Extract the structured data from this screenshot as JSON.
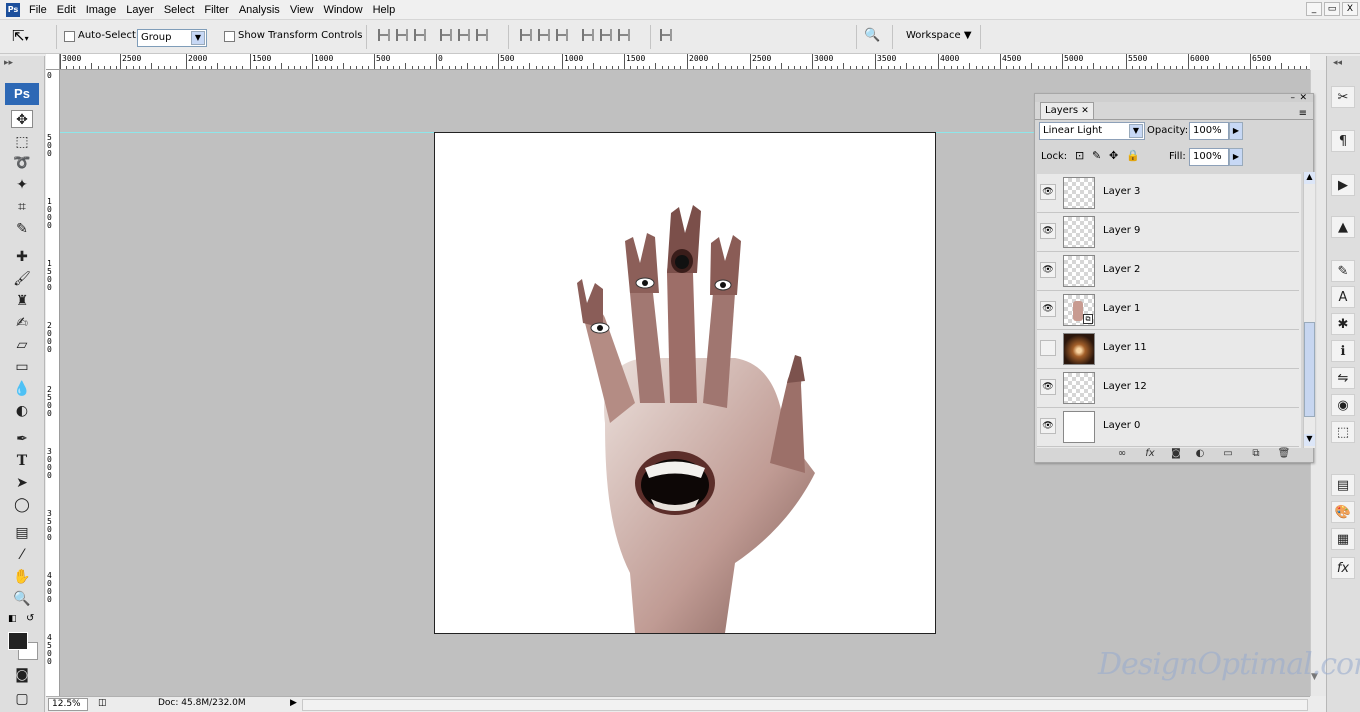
{
  "app": {
    "icon_label": "Ps"
  },
  "menu": [
    "File",
    "Edit",
    "Image",
    "Layer",
    "Select",
    "Filter",
    "Analysis",
    "View",
    "Window",
    "Help"
  ],
  "window_controls": [
    "_",
    "▭",
    "X"
  ],
  "options_bar": {
    "auto_select_label": "Auto-Select:",
    "auto_select_checked": false,
    "auto_select_value": "Group",
    "transform_label": "Show Transform Controls",
    "transform_checked": false,
    "workspace_label": "Workspace"
  },
  "ruler_top_labels": [
    "3000",
    "2500",
    "2000",
    "1500",
    "1000",
    "500",
    "0",
    "500",
    "1000",
    "1500",
    "2000",
    "2500",
    "3000",
    "3500",
    "4000",
    "4500",
    "5000",
    "5500",
    "6000",
    "6500"
  ],
  "ruler_left_labels": [
    "0",
    "500",
    "1000",
    "1500",
    "2000",
    "2500",
    "3000",
    "3500",
    "4000",
    "4500"
  ],
  "status": {
    "zoom": "12.5%",
    "doc": "Doc: 45.8M/232.0M"
  },
  "layers_panel": {
    "tab": "Layers",
    "blend_mode": "Linear Light",
    "opacity_label": "Opacity:",
    "opacity_value": "100%",
    "lock_label": "Lock:",
    "fill_label": "Fill:",
    "fill_value": "100%",
    "layers": [
      {
        "name": "Layer 3",
        "visible": true,
        "thumb": "transparent"
      },
      {
        "name": "Layer 9",
        "visible": true,
        "thumb": "transparent"
      },
      {
        "name": "Layer 2",
        "visible": true,
        "thumb": "transparent"
      },
      {
        "name": "Layer 1",
        "visible": true,
        "thumb": "hand"
      },
      {
        "name": "Layer 11",
        "visible": false,
        "thumb": "glow"
      },
      {
        "name": "Layer 12",
        "visible": true,
        "thumb": "transparent"
      },
      {
        "name": "Layer 0",
        "visible": true,
        "thumb": "white"
      }
    ]
  },
  "watermark": "DesignOptimal.com",
  "colors": {
    "accent_blue": "#2d68b5",
    "canvas_bg": "#c0c0c0",
    "guide": "#8ee6ea"
  }
}
